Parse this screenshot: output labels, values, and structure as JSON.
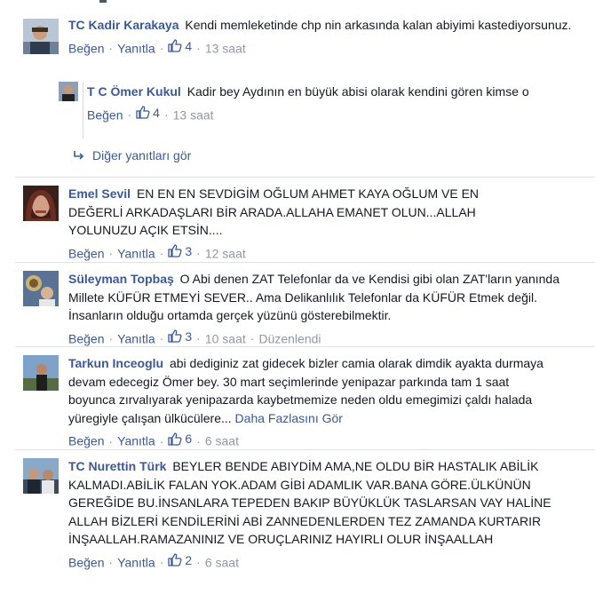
{
  "comments": [
    {
      "author": "TC Kadir Karakaya",
      "text": "Kendi memleketinde chp nin arkasında kalan abiyimi kastediyorsunuz.",
      "like_label": "Beğen",
      "reply_label": "Yanıtla",
      "likes": "4",
      "time": "13 saat",
      "replies": [
        {
          "author": "T C Ömer Kukul",
          "text": "Kadir bey Aydının en büyük abisi olarak kendini gören kimse o",
          "like_label": "Beğen",
          "likes": "4",
          "time": "13 saat"
        }
      ],
      "more_replies": "Diğer yanıtları gör"
    },
    {
      "author": "Emel Sevil",
      "text": "EN EN EN SEVDİGİM OĞLUM AHMET KAYA OĞLUM VE EN DEĞERLİ ARKADAŞLARI BİR ARADA.ALLAHA EMANET OLUN...ALLAH YOLUNUZU AÇIK ETSİN....",
      "like_label": "Beğen",
      "reply_label": "Yanıtla",
      "likes": "3",
      "time": "12 saat"
    },
    {
      "author": "Süleyman Topbaş",
      "text": "O Abi denen ZAT Telefonlar da ve Kendisi gibi olan ZAT'ların yanında Millete KÜFÜR ETMEYİ SEVER.. Ama Delikanlılık Telefonlar da KÜFÜR Etmek değil. İnsanların olduğu ortamda gerçek yüzünü gösterebilmektir.",
      "like_label": "Beğen",
      "reply_label": "Yanıtla",
      "likes": "3",
      "time": "10 saat",
      "edited": "Düzenlendi"
    },
    {
      "author": "Tarkun Inceoglu",
      "text": "abi dediginiz zat gidecek bizler camia olarak dimdik ayakta durmaya devam edecegiz Ömer bey. 30 mart seçimlerinde yenipazar parkında tam 1 saat boyunca zırvalıyarak yenipazarda kaybetmemize neden oldu emegimizi çaldı halada yüregiyle çalışan ülkücülere...",
      "see_more": "Daha Fazlasını Gör",
      "like_label": "Beğen",
      "reply_label": "Yanıtla",
      "likes": "6",
      "time": "6 saat"
    },
    {
      "author": "TC Nurettin Türk",
      "text": "BEYLER BENDE ABIYDİM AMA,NE OLDU BİR HASTALIK ABİLİK KALMADI.ABİLİK FALAN YOK.ADAM GİBİ ADAMLIK VAR.BANA GÖRE.ÜLKÜNÜN GEREĞİDE BU.İNSANLARA TEPEDEN BAKIP BÜYÜKLÜK TASLARSAN VAY HALİNE ALLAH BİZLERİ KENDİLERİNİ ABİ ZANNEDENLERDEN TEZ ZAMANDA KURTARIR İNŞAALLAH.RAMAZANINIZ VE ORUÇLARINIZ HAYIRLI OLUR İNŞAALLAH",
      "like_label": "Beğen",
      "reply_label": "Yanıtla",
      "likes": "2",
      "time": "6 saat"
    }
  ]
}
